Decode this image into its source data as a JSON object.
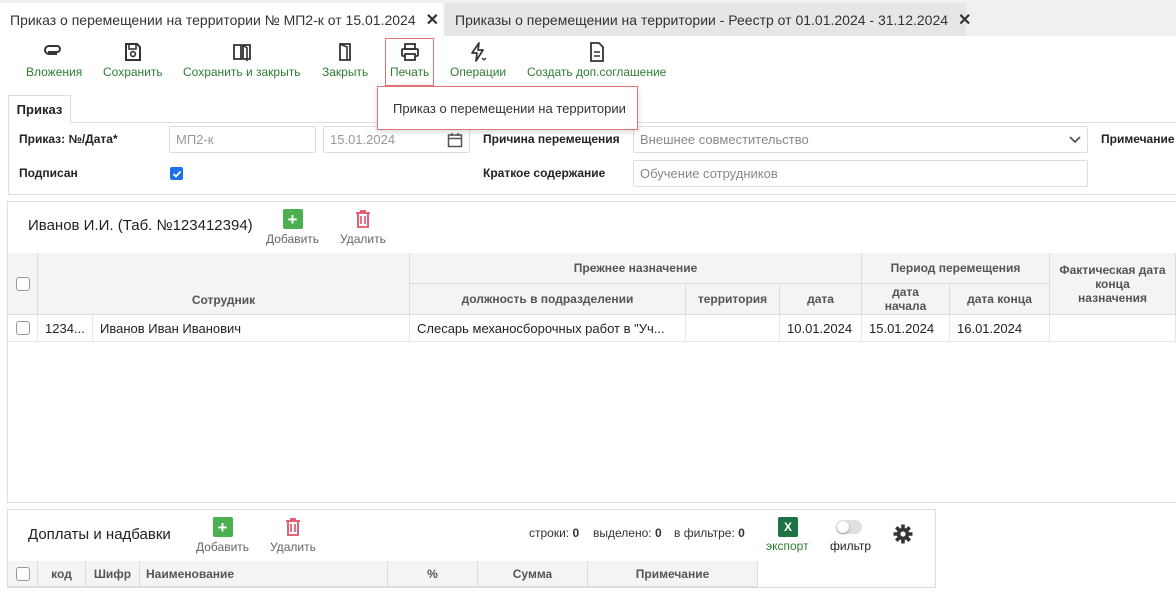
{
  "tabs": [
    {
      "label": "Приказ о перемещении на территории № МП2-к от 15.01.2024",
      "active": true
    },
    {
      "label": "Приказы о перемещении на территории - Реестр от 01.01.2024 - 31.12.2024",
      "active": false
    }
  ],
  "toolbar": {
    "attachments": "Вложения",
    "save": "Сохранить",
    "save_close": "Сохранить и закрыть",
    "close": "Закрыть",
    "print": "Печать",
    "operations": "Операции",
    "create_agreement": "Создать доп.соглашение"
  },
  "print_menu": {
    "item1": "Приказ о перемещении на территории"
  },
  "form": {
    "tab_label": "Приказ",
    "order_label": "Приказ: №/Дата*",
    "order_number": "МП2-к",
    "order_date": "15.01.2024",
    "reason_label": "Причина перемещения",
    "reason_value": "Внешнее совместительство",
    "note_label": "Примечание",
    "signed_label": "Подписан",
    "signed": true,
    "summary_label": "Краткое содержание",
    "summary_value": "Обучение сотрудников"
  },
  "employee_panel": {
    "title": "Иванов И.И. (Таб. №123412394)",
    "add": "Добавить",
    "delete": "Удалить",
    "headers": {
      "employee": "Сотрудник",
      "prev_group": "Прежнее назначение",
      "position": "должность в подразделении",
      "territory": "территория",
      "date": "дата",
      "period_group": "Период перемещения",
      "start_line1": "дата",
      "start_line2": "начала",
      "end": "дата конца",
      "actual_line1": "Фактическая дата",
      "actual_line2": "конца",
      "actual_line3": "назначения"
    },
    "rows": [
      {
        "code": "1234...",
        "name": "Иванов Иван Иванович",
        "position": "Слесарь механосборочных работ в \"Уч...",
        "territory": "",
        "date": "10.01.2024",
        "start": "15.01.2024",
        "end": "16.01.2024",
        "actual": ""
      }
    ]
  },
  "bonus_panel": {
    "title": "Доплаты и надбавки",
    "add": "Добавить",
    "delete": "Удалить",
    "rows_label": "строки:",
    "rows_count": "0",
    "selected_label": "выделено:",
    "selected_count": "0",
    "filter_label": "в фильтре:",
    "filter_count": "0",
    "export": "экспорт",
    "excel_letter": "X",
    "filter_toggle": "фильтр",
    "headers": {
      "code": "код",
      "cipher": "Шифр",
      "name": "Наименование",
      "percent": "%",
      "sum": "Сумма",
      "note": "Примечание"
    }
  },
  "colors": {
    "accent_green": "#2e7d32",
    "highlight_red": "#e57373",
    "checkbox_blue": "#1a73e8",
    "add_green": "#4caf50",
    "delete_red": "#e0506a"
  }
}
